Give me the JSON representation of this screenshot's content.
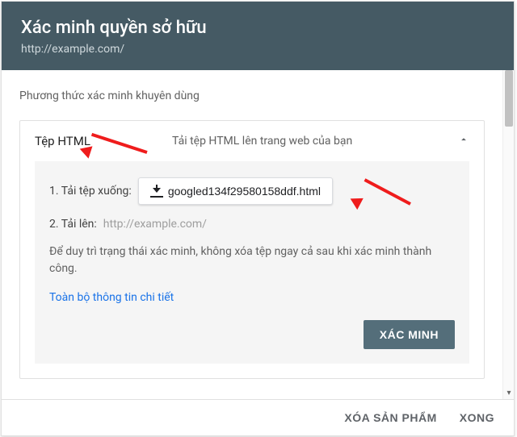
{
  "header": {
    "title": "Xác minh quyền sở hữu",
    "subtitle": "http://example.com/"
  },
  "body": {
    "recommended_label": "Phương thức xác minh khuyên dùng",
    "method": {
      "title": "Tệp HTML",
      "subtitle": "Tải tệp HTML lên trang web của bạn",
      "step1_label": "1. Tải tệp xuống:",
      "download_filename": "googled134f29580158ddf.html",
      "step2_label": "2. Tải lên:",
      "upload_url": "http://example.com/",
      "note": "Để duy trì trạng thái xác minh, không xóa tệp ngay cả sau khi xác minh thành công.",
      "details_link": "Toàn bộ thông tin chi tiết",
      "verify_button": "XÁC MINH"
    }
  },
  "footer": {
    "remove": "XÓA SẢN PHẨM",
    "done": "XONG"
  }
}
